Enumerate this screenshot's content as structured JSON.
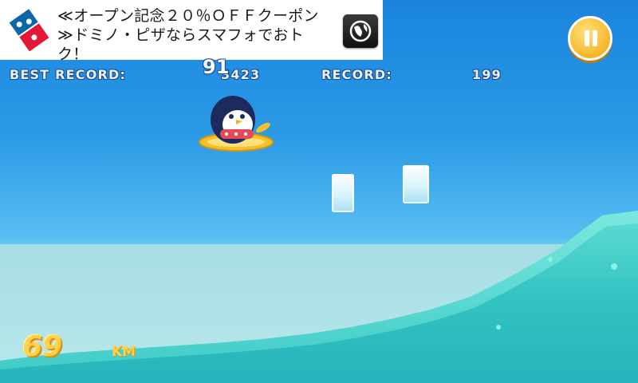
{
  "ad": {
    "text": "≪オープン記念２０％ＯＦＦクーポン\n≫ドミノ・ピザならスマフォでおト\nク！",
    "logo_icon": "dominos-logo-icon",
    "action_icon": "globe-icon"
  },
  "hud": {
    "best_label": "BEST RECORD:",
    "best_value": "3423",
    "record_label": "RECORD:",
    "record_value": "199",
    "combo": "91",
    "pause_icon": "pause-icon"
  },
  "distance": {
    "value": "69",
    "unit": "KM"
  },
  "colors": {
    "sky": "#2a9ae6",
    "sea": "#a5dde4",
    "wave": "#3cc9c4",
    "gold": "#ffd24a"
  }
}
